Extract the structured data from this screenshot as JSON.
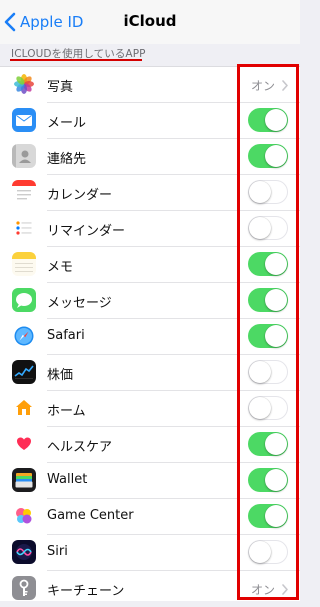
{
  "navbar": {
    "back_label": "Apple ID",
    "title": "iCloud"
  },
  "section": {
    "header": "ICLOUDを使用しているAPP"
  },
  "accent": "#1a7ef7",
  "toggle_on_color": "#4cd964",
  "highlight_color": "#e10000",
  "rows": [
    {
      "label": "写真",
      "icon": "photos-icon",
      "kind": "detail",
      "detail": "オン"
    },
    {
      "label": "メール",
      "icon": "mail-icon",
      "kind": "toggle",
      "on": true
    },
    {
      "label": "連絡先",
      "icon": "contacts-icon",
      "kind": "toggle",
      "on": true
    },
    {
      "label": "カレンダー",
      "icon": "calendar-icon",
      "kind": "toggle",
      "on": false
    },
    {
      "label": "リマインダー",
      "icon": "reminders-icon",
      "kind": "toggle",
      "on": false
    },
    {
      "label": "メモ",
      "icon": "notes-icon",
      "kind": "toggle",
      "on": true
    },
    {
      "label": "メッセージ",
      "icon": "messages-icon",
      "kind": "toggle",
      "on": true
    },
    {
      "label": "Safari",
      "icon": "safari-icon",
      "kind": "toggle",
      "on": true
    },
    {
      "label": "株価",
      "icon": "stocks-icon",
      "kind": "toggle",
      "on": false
    },
    {
      "label": "ホーム",
      "icon": "home-icon",
      "kind": "toggle",
      "on": false
    },
    {
      "label": "ヘルスケア",
      "icon": "health-icon",
      "kind": "toggle",
      "on": true
    },
    {
      "label": "Wallet",
      "icon": "wallet-icon",
      "kind": "toggle",
      "on": true
    },
    {
      "label": "Game Center",
      "icon": "game-center-icon",
      "kind": "toggle",
      "on": true
    },
    {
      "label": "Siri",
      "icon": "siri-icon",
      "kind": "toggle",
      "on": false
    },
    {
      "label": "キーチェーン",
      "icon": "keychain-icon",
      "kind": "detail",
      "detail": "オン"
    }
  ]
}
